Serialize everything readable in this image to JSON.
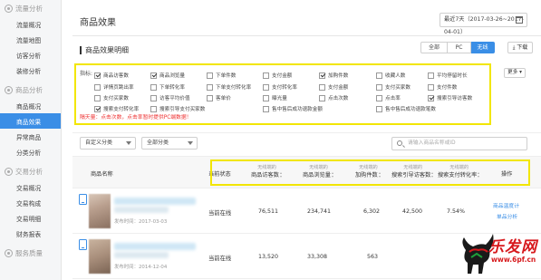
{
  "sidebar": {
    "sections": [
      {
        "title": "流量分析",
        "items": [
          "流量概况",
          "流量地图",
          "访客分析",
          "装修分析"
        ]
      },
      {
        "title": "商品分析",
        "items": [
          "商品概况",
          "商品效果",
          "异常商品",
          "分类分析"
        ]
      },
      {
        "title": "交易分析",
        "items": [
          "交易概况",
          "交易构成",
          "交易明细",
          "财务报表"
        ]
      },
      {
        "title": "服务质量",
        "items": []
      }
    ],
    "active_item": "商品效果"
  },
  "header": {
    "title": "商品效果",
    "date_range": "最近7天（2017-03-26~2017-04-01）"
  },
  "detail": {
    "title": "商品效果明细",
    "device_tabs": [
      "全部",
      "PC",
      "无线"
    ],
    "active_device": "无线",
    "download_label": "下载"
  },
  "indicators": {
    "label": "指标:",
    "more_label": "更多",
    "options": [
      {
        "label": "商品访客数",
        "checked": true
      },
      {
        "label": "商品浏览量",
        "checked": true
      },
      {
        "label": "下单件数",
        "checked": false
      },
      {
        "label": "支付金额",
        "checked": false
      },
      {
        "label": "加购件数",
        "checked": true
      },
      {
        "label": "收藏人数",
        "checked": false
      },
      {
        "label": "平均停留时长",
        "checked": false
      },
      {
        "label": "详情页跳出率",
        "checked": false
      },
      {
        "label": "下单转化率",
        "checked": false
      },
      {
        "label": "下单支付转化率",
        "checked": false
      },
      {
        "label": "支付转化率",
        "checked": false
      },
      {
        "label": "支付金额",
        "checked": false
      },
      {
        "label": "支付买家数",
        "checked": false
      },
      {
        "label": "支付件数",
        "checked": false
      },
      {
        "label": "支付买家数",
        "checked": false
      },
      {
        "label": "访客平均价值",
        "checked": false
      },
      {
        "label": "客单价",
        "checked": false
      },
      {
        "label": "曝光量",
        "checked": false
      },
      {
        "label": "点击次数",
        "checked": false
      },
      {
        "label": "点击率",
        "checked": false
      },
      {
        "label": "搜索引导访客数",
        "checked": true
      },
      {
        "label": "搜索支付转化率",
        "checked": true
      },
      {
        "label": "搜索引导支付买家数",
        "checked": false
      },
      {
        "label": "售中售后成功退款金额",
        "checked": false
      },
      {
        "label": "售中售后成功退款笔数",
        "checked": false
      }
    ],
    "warning": "隔天量：点击次数，点击率暂时提供PC端数据！"
  },
  "filters": {
    "custom_category": "自定义分类",
    "all_category": "全部分类",
    "search_placeholder": "请输入商品名称或ID"
  },
  "table": {
    "col_product": "商品名称",
    "col_status": "当前状态",
    "col_action": "操作",
    "metric_sub": "无线端的",
    "metric_cols": [
      "商品访客数",
      "商品浏览量",
      "加购件数",
      "搜索引导访客数",
      "搜索支付转化率"
    ],
    "rows": [
      {
        "publish": "发布时间：2017-03-03",
        "status": "当前在线",
        "values": [
          "76,511",
          "234,741",
          "6,302",
          "42,500",
          "7.54%"
        ],
        "actions": [
          "商品温度计",
          "单品分析"
        ]
      },
      {
        "publish": "发布时间：2014-12-04",
        "status": "当前在线",
        "values": [
          "13,520",
          "33,308",
          "563",
          "",
          ""
        ],
        "actions": []
      }
    ]
  },
  "watermark": {
    "text": "乐发网",
    "url": "www.6pf.cn"
  }
}
